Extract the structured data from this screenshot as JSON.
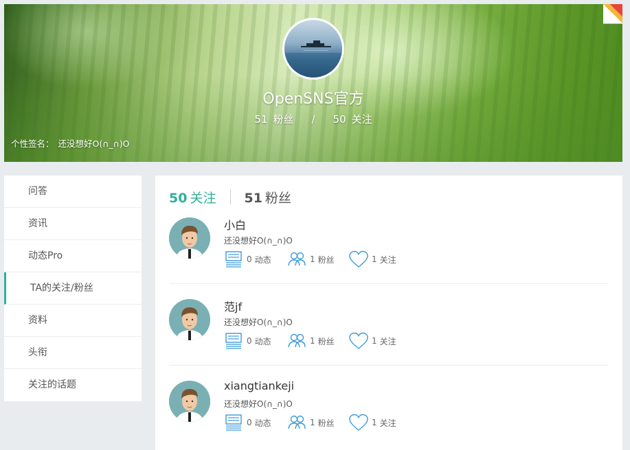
{
  "profile": {
    "name": "OpenSNS官方",
    "fans_count": "51",
    "fans_label": "粉丝",
    "separator": "/",
    "following_count": "50",
    "following_label": "关注",
    "signature_label": "个性签名：",
    "signature_text": "还没想好O(∩_∩)O"
  },
  "sidebar": {
    "items": [
      {
        "label": "问答"
      },
      {
        "label": "资讯"
      },
      {
        "label": "动态Pro"
      },
      {
        "label": "TA的关注/粉丝"
      },
      {
        "label": "资料"
      },
      {
        "label": "头衔"
      },
      {
        "label": "关注的话题"
      }
    ],
    "active_index": 3
  },
  "tabs": {
    "following_count": "50",
    "following_label": "关注",
    "fans_count": "51",
    "fans_label": "粉丝"
  },
  "users": [
    {
      "name": "小白",
      "signature": "还没想好O(∩_∩)O",
      "posts": "0",
      "posts_label": "动态",
      "fans": "1",
      "fans_label": "粉丝",
      "follow": "1",
      "follow_label": "关注"
    },
    {
      "name": "范jf",
      "signature": "还没想好O(∩_∩)O",
      "posts": "0",
      "posts_label": "动态",
      "fans": "1",
      "fans_label": "粉丝",
      "follow": "1",
      "follow_label": "关注"
    },
    {
      "name": "xiangtiankeji",
      "signature": "还没想好O(∩_∩)O",
      "posts": "0",
      "posts_label": "动态",
      "fans": "1",
      "fans_label": "粉丝",
      "follow": "1",
      "follow_label": "关注"
    }
  ],
  "icons": {
    "posts": "posts-stack-icon",
    "fans": "fans-people-icon",
    "follow": "heart-icon"
  },
  "colors": {
    "accent": "#30b09a",
    "icon_blue": "#3a9ad9"
  }
}
